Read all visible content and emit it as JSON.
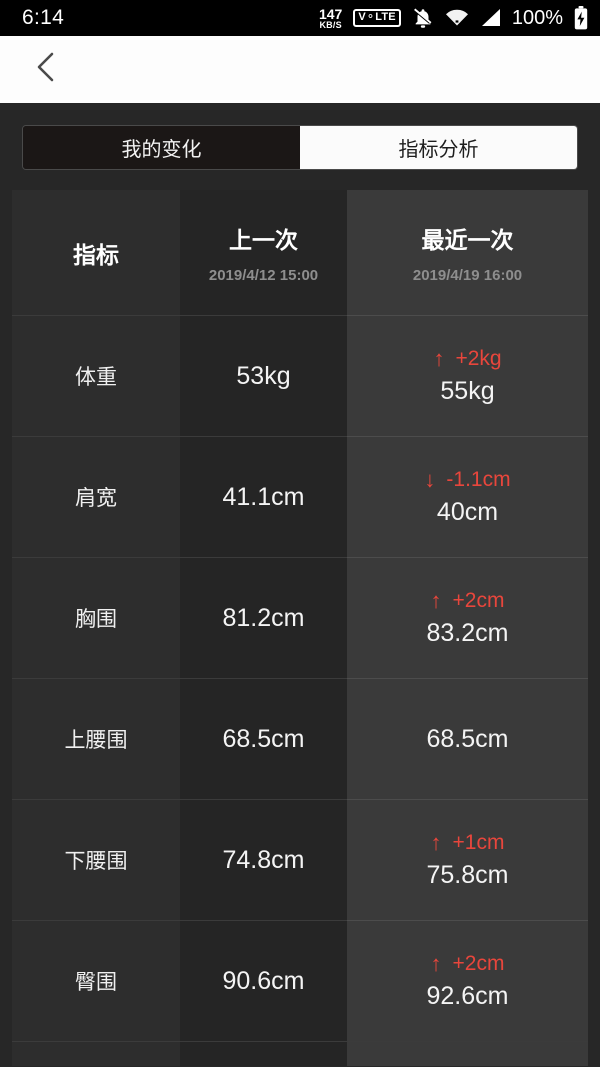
{
  "status_bar": {
    "time": "6:14",
    "net_speed_value": "147",
    "net_speed_unit": "KB/S",
    "volte_label": "V⚬LTE",
    "icons": [
      "notifications-off-icon",
      "wifi-icon",
      "cellular-signal-icon"
    ],
    "battery_percent": "100%",
    "battery_state": "charging"
  },
  "appbar": {
    "back_icon": "chevron-left-icon"
  },
  "tabs": [
    {
      "label": "我的变化",
      "active": true
    },
    {
      "label": "指标分析",
      "active": false
    }
  ],
  "table": {
    "headers": {
      "metric": "指标",
      "previous": {
        "title": "上一次",
        "date": "2019/4/12 15:00"
      },
      "latest": {
        "title": "最近一次",
        "date": "2019/4/19 16:00"
      }
    },
    "rows": [
      {
        "metric": "体重",
        "previous": "53kg",
        "latest": "55kg",
        "delta": "+2kg",
        "direction": "up",
        "arrow": "↑"
      },
      {
        "metric": "肩宽",
        "previous": "41.1cm",
        "latest": "40cm",
        "delta": "-1.1cm",
        "direction": "down",
        "arrow": "↓"
      },
      {
        "metric": "胸围",
        "previous": "81.2cm",
        "latest": "83.2cm",
        "delta": "+2cm",
        "direction": "up",
        "arrow": "↑"
      },
      {
        "metric": "上腰围",
        "previous": "68.5cm",
        "latest": "68.5cm",
        "delta": "",
        "direction": "none",
        "arrow": ""
      },
      {
        "metric": "下腰围",
        "previous": "74.8cm",
        "latest": "75.8cm",
        "delta": "+1cm",
        "direction": "up",
        "arrow": "↑"
      },
      {
        "metric": "臀围",
        "previous": "90.6cm",
        "latest": "92.6cm",
        "delta": "+2cm",
        "direction": "up",
        "arrow": "↑"
      }
    ]
  },
  "colors": {
    "page_background": "#272727",
    "column_metric": "#2d2d2d",
    "column_previous": "#252525",
    "column_latest_highlight": "#3a3a3a",
    "delta_red": "#e8463c",
    "appbar_white": "#fdfdfd",
    "tab_active_bg": "#1b1716"
  }
}
